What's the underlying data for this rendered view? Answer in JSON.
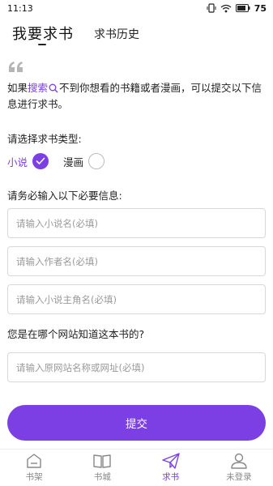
{
  "status_bar": {
    "time": "11:13",
    "battery": "75",
    "icons": [
      "vibrate-icon",
      "wifi-icon",
      "battery-icon"
    ]
  },
  "header": {
    "tabs": [
      {
        "label": "我要求书",
        "active": true
      },
      {
        "label": "求书历史",
        "active": false
      }
    ]
  },
  "intro": {
    "prefix": "如果",
    "link": "搜索",
    "suffix": "不到你想看的书籍或者漫画，可以提交以下信息进行求书。"
  },
  "type_section": {
    "label": "请选择求书类型:",
    "options": [
      {
        "label": "小说",
        "selected": true
      },
      {
        "label": "漫画",
        "selected": false
      }
    ]
  },
  "required_section": {
    "label": "请务必输入以下必要信息:",
    "fields": [
      {
        "placeholder": "请输入小说名(必填)",
        "value": ""
      },
      {
        "placeholder": "请输入作者名(必填)",
        "value": ""
      },
      {
        "placeholder": "请输入小说主角名(必填)",
        "value": ""
      }
    ]
  },
  "source_section": {
    "label": "您是在哪个网站知道这本书的?",
    "field": {
      "placeholder": "请输入原网站名称或网址(必填)",
      "value": ""
    }
  },
  "submit_label": "提交",
  "bottom_nav": [
    {
      "label": "书架",
      "icon": "bookshelf-icon",
      "active": false
    },
    {
      "label": "书城",
      "icon": "book-icon",
      "active": false
    },
    {
      "label": "求书",
      "icon": "send-icon",
      "active": true
    },
    {
      "label": "未登录",
      "icon": "user-icon",
      "active": false
    }
  ],
  "colors": {
    "accent": "#7b3fe4",
    "text": "#222222",
    "muted": "#888888"
  }
}
